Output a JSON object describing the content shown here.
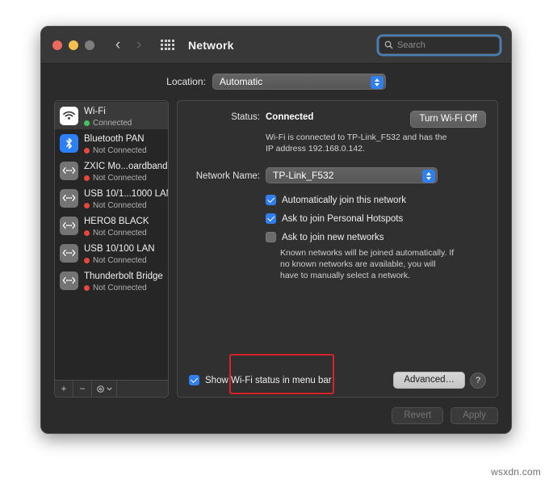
{
  "window": {
    "title": "Network",
    "traffic_lights": [
      "close",
      "minimize",
      "zoom"
    ],
    "search": {
      "placeholder": "Search",
      "value": ""
    }
  },
  "location": {
    "label": "Location:",
    "value": "Automatic"
  },
  "sidebar": {
    "services": [
      {
        "name": "Wi-Fi",
        "status": "Connected",
        "connected": true,
        "icon": "wifi-icon",
        "selected": true
      },
      {
        "name": "Bluetooth PAN",
        "status": "Not Connected",
        "connected": false,
        "icon": "bluetooth-icon",
        "selected": false
      },
      {
        "name": "ZXIC Mo...oardband",
        "status": "Not Connected",
        "connected": false,
        "icon": "ethernet-icon",
        "selected": false
      },
      {
        "name": "USB 10/1...1000 LAN",
        "status": "Not Connected",
        "connected": false,
        "icon": "ethernet-icon",
        "selected": false
      },
      {
        "name": "HERO8 BLACK",
        "status": "Not Connected",
        "connected": false,
        "icon": "ethernet-icon",
        "selected": false
      },
      {
        "name": "USB 10/100 LAN",
        "status": "Not Connected",
        "connected": false,
        "icon": "ethernet-icon",
        "selected": false
      },
      {
        "name": "Thunderbolt Bridge",
        "status": "Not Connected",
        "connected": false,
        "icon": "ethernet-icon",
        "selected": false
      }
    ],
    "toolbar": {
      "add": "+",
      "remove": "−",
      "actions": "⚙"
    }
  },
  "detail": {
    "status_label": "Status:",
    "status_value": "Connected",
    "wifi_toggle_label": "Turn Wi-Fi Off",
    "description": "Wi-Fi is connected to TP-Link_F532 and has the IP address 192.168.0.142.",
    "network_name_label": "Network Name:",
    "network_name_value": "TP-Link_F532",
    "checkboxes": [
      {
        "label": "Automatically join this network",
        "checked": true
      },
      {
        "label": "Ask to join Personal Hotspots",
        "checked": true
      },
      {
        "label": "Ask to join new networks",
        "checked": false
      }
    ],
    "hint": "Known networks will be joined automatically. If no known networks are available, you will have to manually select a network.",
    "show_status_label": "Show Wi-Fi status in menu bar",
    "show_status_checked": true,
    "advanced_label": "Advanced…",
    "help_label": "?"
  },
  "footer": {
    "revert_label": "Revert",
    "apply_label": "Apply"
  },
  "watermark": "wsxdn.com",
  "colors": {
    "accent_blue": "#2f7ff0",
    "connected_green": "#45c55a",
    "disconnected_red": "#e8483c",
    "annotation_red": "#d8222a"
  }
}
